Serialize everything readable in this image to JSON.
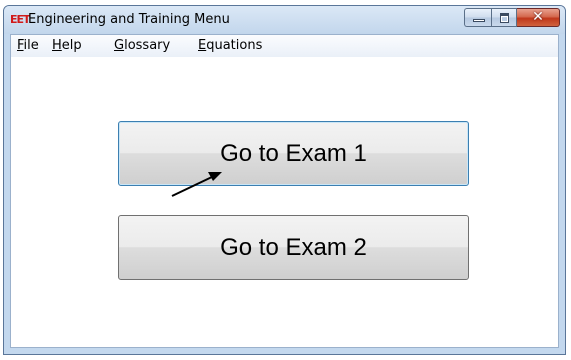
{
  "window": {
    "icon_text": "EET",
    "title": "Engineering and Training Menu",
    "caption_buttons": {
      "minimize_icon": "minimize-icon",
      "maximize_icon": "maximize-icon",
      "close_icon": "close-icon",
      "close_glyph": "✕"
    }
  },
  "menu": [
    {
      "first": "F",
      "rest": "ile"
    },
    {
      "first": "H",
      "rest": "elp"
    },
    {
      "first": "G",
      "rest": "lossary"
    },
    {
      "first": "E",
      "rest": "quations"
    }
  ],
  "buttons": {
    "exam1": "Go to Exam 1",
    "exam2": "Go to Exam 2"
  },
  "colors": {
    "icon_red": "#d11a1a",
    "focus_border": "#3c7fb1",
    "close_red": "#c0381b"
  }
}
